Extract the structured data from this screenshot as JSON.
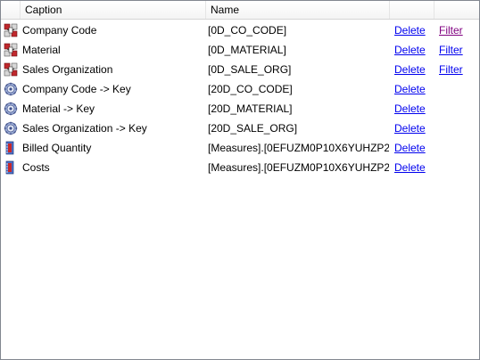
{
  "header": {
    "caption": "Caption",
    "name": "Name"
  },
  "rows": [
    {
      "icon": "characteristic-icon",
      "caption": "Company Code",
      "name": "[0D_CO_CODE]",
      "delete": "Delete",
      "filter": "Filter",
      "filter_visited": true
    },
    {
      "icon": "characteristic-icon",
      "caption": "Material",
      "name": "[0D_MATERIAL]",
      "delete": "Delete",
      "filter": "Filter"
    },
    {
      "icon": "characteristic-icon",
      "caption": "Sales Organization",
      "name": "[0D_SALE_ORG]",
      "delete": "Delete",
      "filter": "Filter"
    },
    {
      "icon": "key-gear-icon",
      "caption": "Company Code -> Key",
      "name": "[20D_CO_CODE]",
      "delete": "Delete"
    },
    {
      "icon": "key-gear-icon",
      "caption": "Material -> Key",
      "name": "[20D_MATERIAL]",
      "delete": "Delete"
    },
    {
      "icon": "key-gear-icon",
      "caption": "Sales Organization -> Key",
      "name": "[20D_SALE_ORG]",
      "delete": "Delete"
    },
    {
      "icon": "measure-icon",
      "caption": "Billed Quantity",
      "name": "[Measures].[0EFUZM0P10X6YUHZP2C...",
      "delete": "Delete"
    },
    {
      "icon": "measure-icon",
      "caption": "Costs",
      "name": "[Measures].[0EFUZM0P10X6YUHZP2C...",
      "delete": "Delete"
    }
  ],
  "colors": {
    "link": "#0000ee",
    "link_visited": "#800080",
    "border": "#828790"
  }
}
